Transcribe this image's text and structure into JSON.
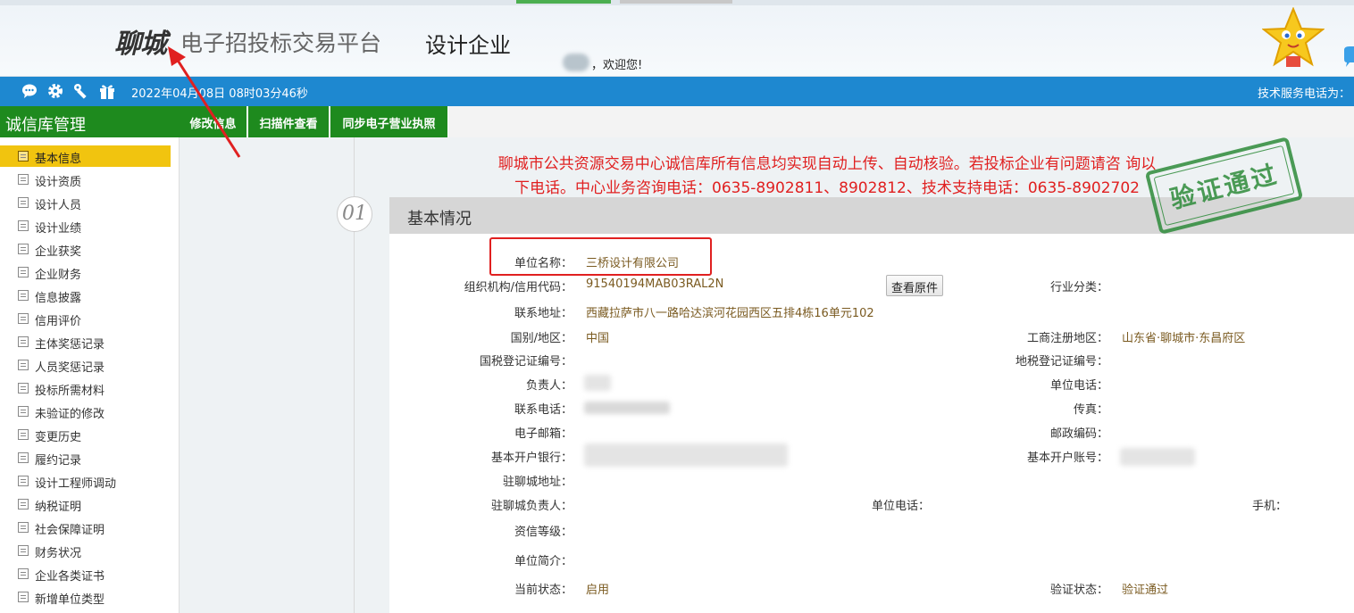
{
  "header": {
    "logo_city": "聊城",
    "logo_platform": "电子招投标交易平台",
    "role": "设计企业",
    "welcome": "，欢迎您!"
  },
  "toolbar": {
    "icons": [
      "chat-icon",
      "gear-icon",
      "tools-icon",
      "gift-icon"
    ],
    "datetime": "2022年04月08日 08时03分46秒",
    "support_phone_label": "技术服务电话为："
  },
  "sidebar": {
    "title": "诚信库管理",
    "items": [
      {
        "label": "基本信息",
        "active": true
      },
      {
        "label": "设计资质"
      },
      {
        "label": "设计人员"
      },
      {
        "label": "设计业绩"
      },
      {
        "label": "企业获奖"
      },
      {
        "label": "企业财务"
      },
      {
        "label": "信息披露"
      },
      {
        "label": "信用评价"
      },
      {
        "label": "主体奖惩记录"
      },
      {
        "label": "人员奖惩记录"
      },
      {
        "label": "投标所需材料"
      },
      {
        "label": "未验证的修改"
      },
      {
        "label": "变更历史"
      },
      {
        "label": "履约记录"
      },
      {
        "label": "设计工程师调动"
      },
      {
        "label": "纳税证明"
      },
      {
        "label": "社会保障证明"
      },
      {
        "label": "财务状况"
      },
      {
        "label": "企业各类证书"
      },
      {
        "label": "新增单位类型"
      }
    ]
  },
  "tabs": [
    {
      "label": "修改信息"
    },
    {
      "label": "扫描件查看"
    },
    {
      "label": "同步电子营业执照"
    }
  ],
  "notice": {
    "line1": "聊城市公共资源交易中心诚信库所有信息均实现自动上传、自动核验。若投标企业有问题请咨 询以",
    "line2": "下电话。中心业务咨询电话：0635-8902811、8902812、技术支持电话：0635-8902702"
  },
  "stamp": {
    "text": "验证通过",
    "color": "#2e8b3a"
  },
  "section": {
    "number": "01",
    "title": "基本情况"
  },
  "fields": {
    "unit_name": {
      "label": "单位名称：",
      "value": "三桥设计有限公司"
    },
    "org_code": {
      "label": "组织机构/信用代码：",
      "value": "91540194MAB03RAL2N"
    },
    "view_original": "查看原件",
    "industry": {
      "label": "行业分类：",
      "value": ""
    },
    "address": {
      "label": "联系地址：",
      "value": "西藏拉萨市八一路哈达滨河花园西区五排4栋16单元102"
    },
    "country": {
      "label": "国别/地区：",
      "value": "中国"
    },
    "reg_area": {
      "label": "工商注册地区：",
      "value": "山东省·聊城市·东昌府区"
    },
    "national_tax": {
      "label": "国税登记证编号：",
      "value": ""
    },
    "local_tax": {
      "label": "地税登记证编号：",
      "value": ""
    },
    "principal": {
      "label": "负责人：",
      "value": ""
    },
    "unit_phone": {
      "label": "单位电话：",
      "value": ""
    },
    "contact_phone": {
      "label": "联系电话：",
      "value": ""
    },
    "fax": {
      "label": "传真：",
      "value": ""
    },
    "email": {
      "label": "电子邮箱：",
      "value": ""
    },
    "postcode": {
      "label": "邮政编码：",
      "value": ""
    },
    "bank": {
      "label": "基本开户银行：",
      "value": ""
    },
    "bank_account": {
      "label": "基本开户账号：",
      "value": ""
    },
    "lc_address": {
      "label": "驻聊城地址：",
      "value": ""
    },
    "lc_principal": {
      "label": "驻聊城负责人：",
      "value": ""
    },
    "lc_unit_phone": {
      "label": "单位电话：",
      "value": ""
    },
    "mobile": {
      "label": "手机：",
      "value": ""
    },
    "credit_level": {
      "label": "资信等级：",
      "value": ""
    },
    "profile": {
      "label": "单位简介：",
      "value": ""
    },
    "status": {
      "label": "当前状态：",
      "value": "启用"
    },
    "verify_status": {
      "label": "验证状态：",
      "value": "验证通过"
    }
  },
  "colors": {
    "accent_blue": "#1e88d0",
    "accent_green": "#1e8a1e",
    "active_item": "#f1c40f",
    "notice_red": "#e02020",
    "value_brown": "#7a5a20"
  }
}
